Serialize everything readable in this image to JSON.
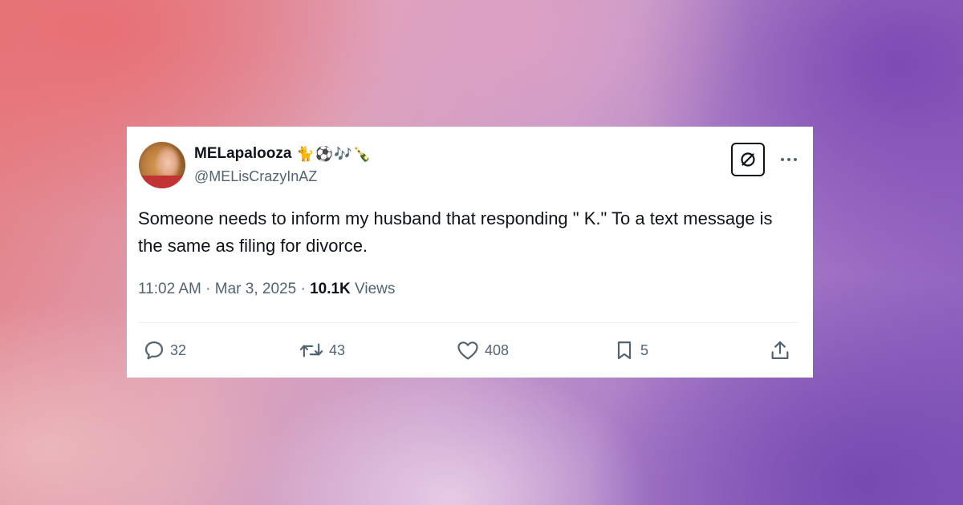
{
  "tweet": {
    "display_name": "MELapalooza",
    "name_emojis": "🐈⚽🎶🍾",
    "handle": "@MELisCrazyInAZ",
    "text": "Someone needs to inform my husband that responding \" K.\" To a text message is the same as filing for divorce.",
    "time": "11:02 AM",
    "date": "Mar 3, 2025",
    "separator": "·",
    "views_count": "10.1K",
    "views_label": "Views"
  },
  "actions": {
    "replies": "32",
    "reposts": "43",
    "likes": "408",
    "bookmarks": "5"
  },
  "icons": {
    "reply": "reply-icon",
    "repost": "repost-icon",
    "like": "heart-icon",
    "bookmark": "bookmark-icon",
    "share": "share-icon",
    "grok": "grok-icon",
    "more": "more-icon"
  },
  "colors": {
    "text_primary": "#0f1419",
    "text_secondary": "#536471",
    "card_background": "#ffffff"
  }
}
